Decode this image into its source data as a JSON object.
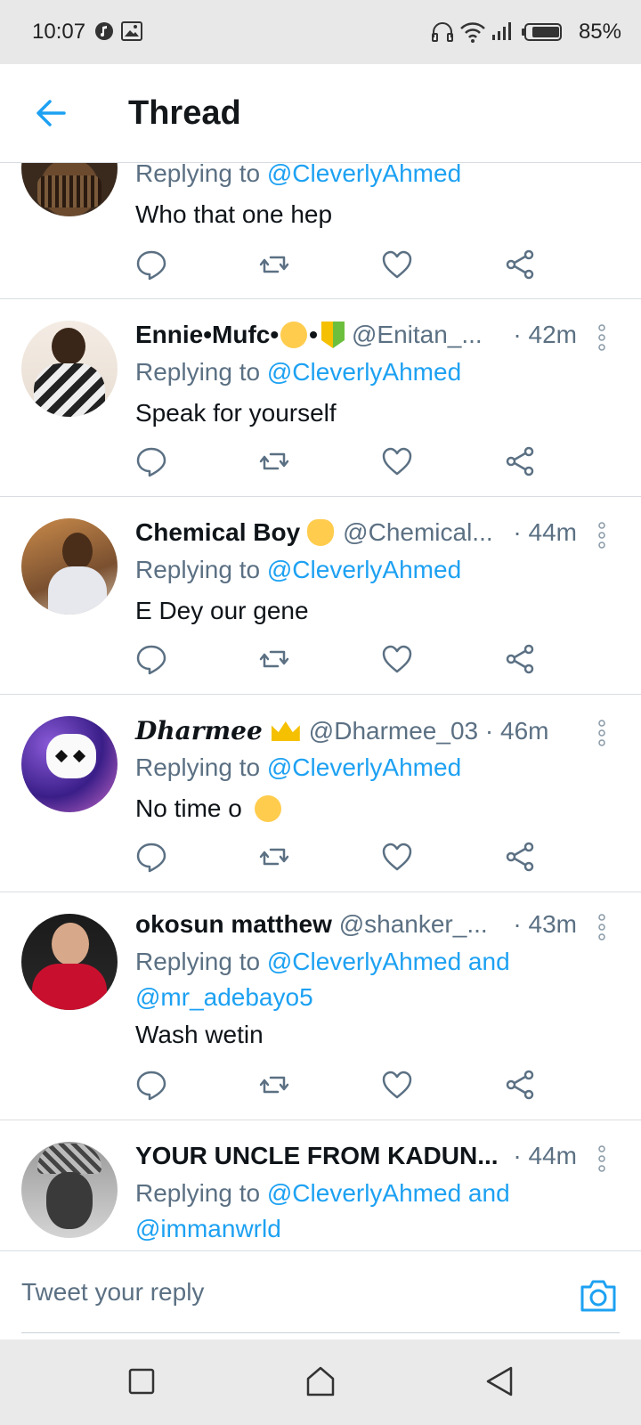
{
  "status_bar": {
    "time": "10:07",
    "battery": "85%",
    "icons": [
      "music-icon",
      "image-icon",
      "headphones-icon",
      "wifi-icon",
      "signal-icon",
      "battery-icon"
    ]
  },
  "header": {
    "title": "Thread",
    "back_icon": "arrow-left-icon",
    "accent": "#1da1f2"
  },
  "tweets": [
    {
      "name": "",
      "handle": "",
      "time": "",
      "replying_prefix": "Replying to ",
      "replying_to": "@CleverlyAhmed",
      "text": "Who that one hep"
    },
    {
      "name": "Ennie•Mufc•",
      "name_suffix": "•",
      "handle": "@Enitan_...",
      "time": "· 42m",
      "replying_prefix": "Replying to ",
      "replying_to": "@CleverlyAhmed",
      "text": "Speak for yourself"
    },
    {
      "name": "Chemical Boy",
      "handle": "@Chemical...",
      "time": "· 44m",
      "replying_prefix": "Replying to ",
      "replying_to": "@CleverlyAhmed",
      "text": "E Dey our gene"
    },
    {
      "name": "Dharmee",
      "handle": "@Dharmee_03",
      "time": "· 46m",
      "replying_prefix": "Replying to ",
      "replying_to": "@CleverlyAhmed",
      "text": "No time o"
    },
    {
      "name": "okosun matthew",
      "handle": "@shanker_...",
      "time": "· 43m",
      "replying_prefix": "Replying to ",
      "replying_to": "@CleverlyAhmed and",
      "replying_to_2": "@mr_adebayo5",
      "text": "Wash wetin"
    },
    {
      "name": "YOUR UNCLE FROM KADUN...",
      "handle": "",
      "time": "· 44m",
      "replying_prefix": "Replying to ",
      "replying_to": "@CleverlyAhmed and",
      "replying_to_2": "@immanwrld"
    }
  ],
  "reply_bar": {
    "placeholder": "Tweet your reply",
    "camera_icon": "camera-icon"
  },
  "nav_bar": {
    "icons": [
      "recents-square-icon",
      "home-icon",
      "back-triangle-icon"
    ]
  }
}
